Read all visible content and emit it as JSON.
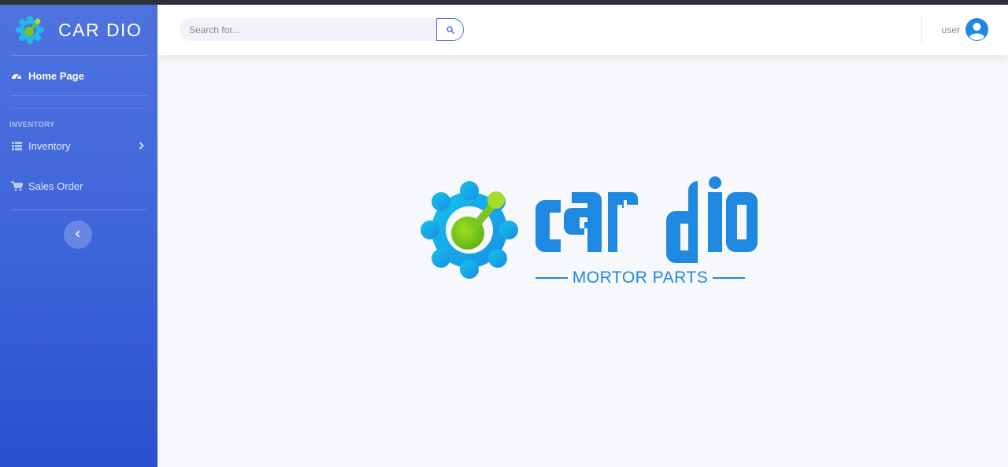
{
  "brand": {
    "name": "CAR DIO"
  },
  "sidebar": {
    "home_label": "Home Page",
    "heading": "INVENTORY",
    "items": [
      {
        "label": "Inventory",
        "icon": "table-icon"
      },
      {
        "label": "Sales Order",
        "icon": "cart-icon"
      }
    ]
  },
  "topbar": {
    "search_placeholder": "Search for...",
    "user_name": "user"
  },
  "hero_logo": {
    "wordmark": "car dio",
    "tagline": "MORTOR PARTS"
  },
  "colors": {
    "sidebar_top": "#4e73df",
    "sidebar_bottom": "#2a4fcf",
    "logo_blue": "#1f88e0",
    "logo_green": "#7cc420",
    "gear_cyan": "#14b6e8"
  }
}
